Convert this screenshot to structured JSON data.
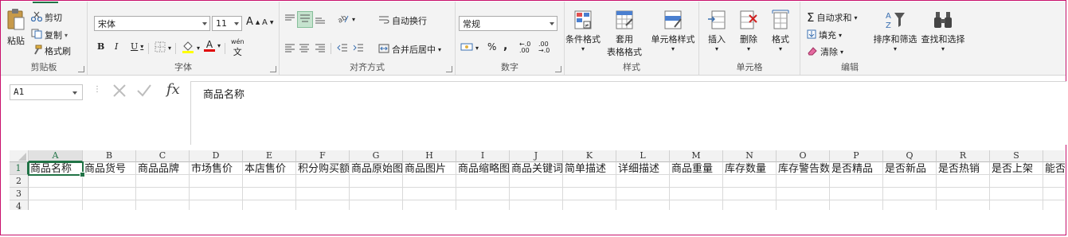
{
  "colors": {
    "accent": "#217346",
    "frame": "#c8106b"
  },
  "clipboard": {
    "paste": "粘贴",
    "cut": "剪切",
    "copy": "复制",
    "painter": "格式刷",
    "group": "剪贴板"
  },
  "font": {
    "name": "宋体",
    "size": "11",
    "group": "字体",
    "bold": "B",
    "italic": "I",
    "underline": "U",
    "grow": "A",
    "shrink": "A",
    "color_a": "A",
    "phonetic": "wén"
  },
  "alignment": {
    "wrap": "自动换行",
    "merge": "合并后居中",
    "group": "对齐方式"
  },
  "number": {
    "format": "常规",
    "percent": "%",
    "comma": ",",
    "inc": "←.0 .00",
    "dec": ".00 →.0",
    "group": "数字"
  },
  "styles": {
    "conditional": "条件格式",
    "table_a": "套用",
    "table_b": "表格格式",
    "cell": "单元格样式",
    "group": "样式"
  },
  "cells": {
    "insert": "插入",
    "delete": "删除",
    "format": "格式",
    "group": "单元格"
  },
  "editing": {
    "autosum": "自动求和",
    "fill": "填充",
    "clear": "清除",
    "sort": "排序和筛选",
    "find": "查找和选择",
    "group": "编辑"
  },
  "formula_bar": {
    "name_box": "A1",
    "fx": "fx",
    "content": "商品名称"
  },
  "sheet": {
    "columns": [
      "A",
      "B",
      "C",
      "D",
      "E",
      "F",
      "G",
      "H",
      "I",
      "J",
      "K",
      "L",
      "M",
      "N",
      "O",
      "P",
      "Q",
      "R",
      "S"
    ],
    "rows": [
      "1",
      "2",
      "3",
      "4"
    ],
    "row1": [
      "商品名称",
      "商品货号",
      "商品品牌",
      "市场售价",
      "本店售价",
      "积分购买额",
      "商品原始图",
      "商品图片",
      "商品缩略图",
      "商品关键词",
      "简单描述",
      "详细描述",
      "商品重量",
      "库存数量",
      "库存警告数",
      "是否精品",
      "是否新品",
      "是否热销",
      "是否上架",
      "能否"
    ]
  }
}
